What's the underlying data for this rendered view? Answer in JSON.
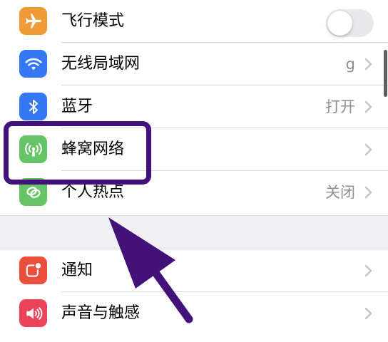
{
  "settings": {
    "group1": [
      {
        "name": "airplane-mode",
        "label": "飞行模式",
        "icon": "airplane-icon",
        "icon_color": "#f09a37",
        "control": "toggle",
        "toggle_on": false
      },
      {
        "name": "wifi",
        "label": "无线局域网",
        "value": "g",
        "icon": "wifi-icon",
        "icon_color": "#3478f6"
      },
      {
        "name": "bluetooth",
        "label": "蓝牙",
        "value": "打开",
        "icon": "bluetooth-icon",
        "icon_color": "#3478f6"
      },
      {
        "name": "cellular",
        "label": "蜂窝网络",
        "value": "",
        "icon": "cellular-antenna-icon",
        "icon_color": "#65c466"
      },
      {
        "name": "personal-hotspot",
        "label": "个人热点",
        "value": "关闭",
        "icon": "hotspot-chain-icon",
        "icon_color": "#65c466"
      }
    ],
    "group2": [
      {
        "name": "notifications",
        "label": "通知",
        "icon": "notification-icon",
        "icon_color": "#eb4e3d"
      },
      {
        "name": "sounds",
        "label": "声音与触感",
        "icon": "speaker-icon",
        "icon_color": "#eb445a"
      }
    ]
  },
  "annotation": {
    "highlight_color": "#42127a",
    "highlighted_item": "cellular",
    "arrow_color": "#42127a"
  }
}
